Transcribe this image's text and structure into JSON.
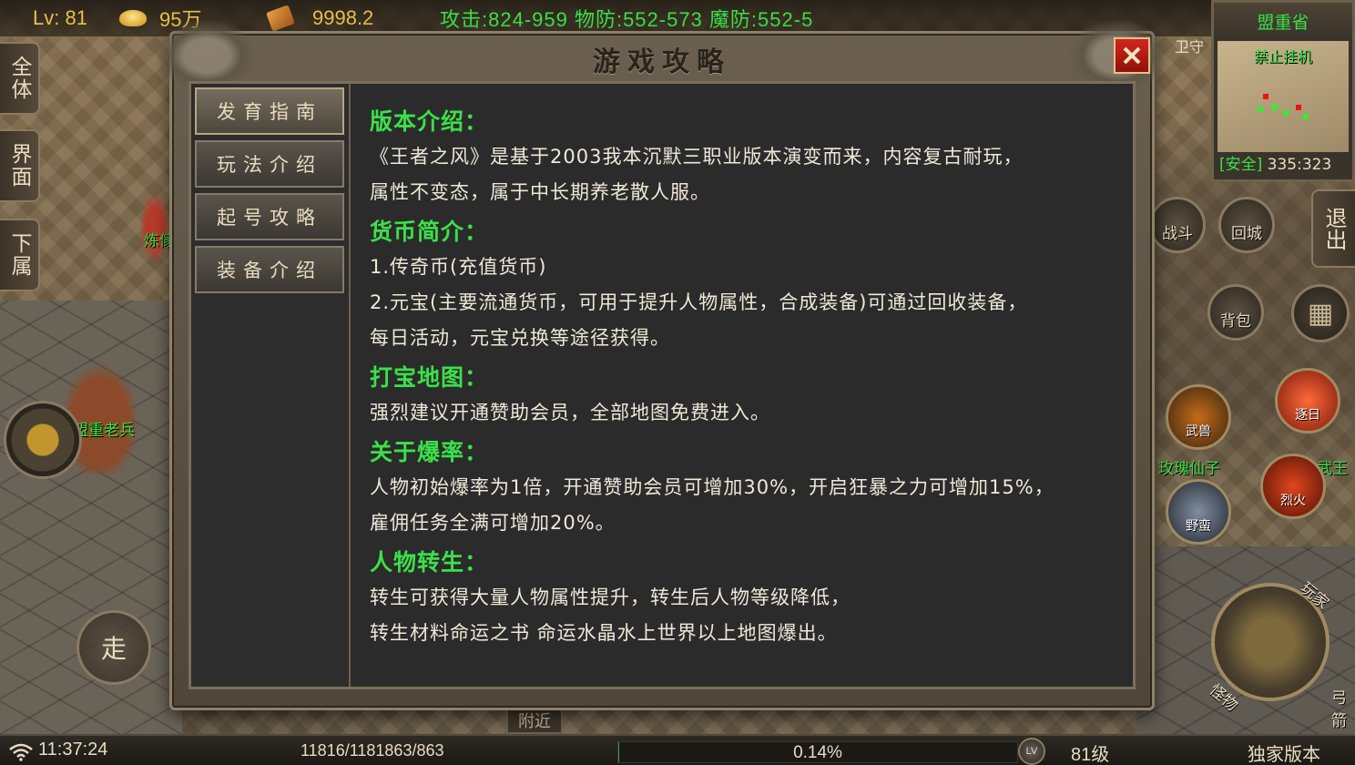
{
  "hud": {
    "level": "Lv: 81",
    "gold": "95",
    "gold_unit": "万",
    "yuanbao": "9998.2",
    "stats": "攻击:824-959 物防:552-573 魔防:552-5"
  },
  "side_tabs": [
    "全体",
    "界面",
    "下属"
  ],
  "world": {
    "npc_lianqi": "炼傢",
    "npc_veteran": "盟重老兵",
    "walk": "走",
    "guard": "卫守",
    "player_name": "玫瑰仙子",
    "player_name2": "武王"
  },
  "minimap": {
    "region": "盟重省",
    "notice": "禁止挂机",
    "safe": "[安全]",
    "coords": "335:323"
  },
  "right_controls": {
    "battle": "战斗",
    "return_city": "回城",
    "exit": "退出",
    "bag": "背包",
    "skill_wushou": "武兽",
    "skill_zhuri": "逐日",
    "skill_liehuo": "烈火",
    "skill_yeman": "野蛮",
    "attack_player": "玩家",
    "attack_monster": "怪物",
    "far_right": "弓箭"
  },
  "dialog": {
    "title": "游戏攻略",
    "menu": [
      "发育指南",
      "玩法介绍",
      "起号攻略",
      "装备介绍"
    ],
    "active_menu": 0,
    "sections": [
      {
        "title": "版本介绍：",
        "lines": [
          "《王者之风》是基于2003我本沉默三职业版本演变而来，内容复古耐玩，",
          "属性不变态，属于中长期养老散人服。"
        ]
      },
      {
        "title": "货币简介：",
        "lines": [
          "1.传奇币(充值货币)",
          "2.元宝(主要流通货币，可用于提升人物属性，合成装备)可通过回收装备，",
          "每日活动，元宝兑换等途径获得。"
        ]
      },
      {
        "title": "打宝地图：",
        "lines": [
          "强烈建议开通赞助会员，全部地图免费进入。"
        ]
      },
      {
        "title": "关于爆率：",
        "lines": [
          "人物初始爆率为1倍，开通赞助会员可增加30%，开启狂暴之力可增加15%，",
          "雇佣任务全满可增加20%。"
        ]
      },
      {
        "title": "人物转生：",
        "lines": [
          "转生可获得大量人物属性提升，转生后人物等级降低，",
          "转生材料命运之书 命运水晶水上世界以上地图爆出。"
        ]
      }
    ]
  },
  "bottombar": {
    "time": "11:37:24",
    "hp_mp": "11816/1181863/863",
    "exp_percent": "0.14%",
    "exp_fraction": 0.0014,
    "lv_icon": "LV",
    "level": "81级",
    "version": "独家版本",
    "nearby": "附近"
  },
  "colors": {
    "accent_green": "#3be04a",
    "gold": "#e6c04a",
    "close_red": "#d2261c"
  }
}
